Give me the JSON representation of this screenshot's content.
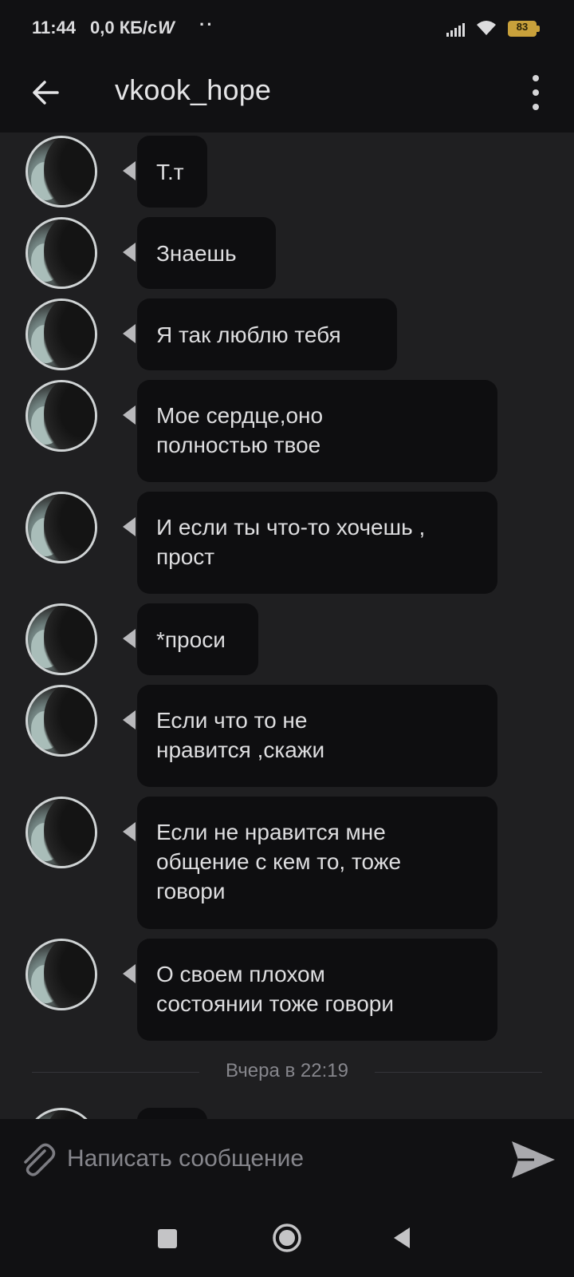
{
  "status_bar": {
    "time": "11:44",
    "speed": "0,0 КБ/с",
    "battery": "83",
    "icons": [
      "w-icon",
      "dots-icon",
      "signal-icon",
      "wifi-icon",
      "battery-icon"
    ]
  },
  "header": {
    "title": "vkook_hope",
    "back_icon": "arrow-left-icon",
    "menu_icon": "more-vertical-icon"
  },
  "messages": [
    {
      "text": "Т.т"
    },
    {
      "text": "Знаешь"
    },
    {
      "text": "Я так люблю тебя"
    },
    {
      "text": "Мое сердце,оно\nполностью твое"
    },
    {
      "text": "И если ты что-то хочешь ,\nпрост"
    },
    {
      "text": "*проси"
    },
    {
      "text": "Если что то не\nнравится ,скажи"
    },
    {
      "text": "Если не нравится мне\nобщение с кем то, тоже\nговори"
    },
    {
      "text": "О своем плохом\nсостоянии тоже говори"
    }
  ],
  "date_divider": "Вчера в 22:19",
  "composer": {
    "placeholder": "Написать сообщение",
    "attach_icon": "paperclip-icon",
    "send_icon": "send-icon"
  },
  "nav_bar": {
    "icons": [
      "recents-icon",
      "home-icon",
      "back-icon"
    ]
  },
  "colors": {
    "background": "#1f1f21",
    "bar": "#111113",
    "bubble": "#0e0e10",
    "battery": "#c9a13b"
  }
}
